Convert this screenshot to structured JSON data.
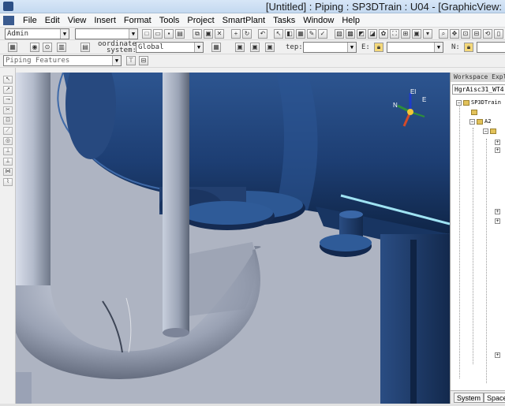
{
  "window": {
    "title": "[Untitled] : Piping : SP3DTrain : U04 - [GraphicView:"
  },
  "menu": [
    "File",
    "Edit",
    "View",
    "Insert",
    "Format",
    "Tools",
    "Project",
    "SmartPlant",
    "Tasks",
    "Window",
    "Help"
  ],
  "toolbar": {
    "task_combo": "Admin",
    "second_combo": "",
    "coordinate_label_line1": "oordinate",
    "coordinate_label_line2": "system:",
    "coordinate_combo": "Global",
    "step_label": "tep:",
    "step_combo": "",
    "e_label": "E:",
    "e_combo": "",
    "n_label": "N:",
    "n_combo": "",
    "filter_combo": "Piping Features"
  },
  "viewport": {
    "compass": {
      "east": "E",
      "north": "N",
      "elevation": "El"
    },
    "colors": {
      "background": "#aeb4c2",
      "vessel": "#1e3f72",
      "pipe": "#b7bfcf"
    }
  },
  "workspace": {
    "header": "Workspace Explorer",
    "filter": "HgrAisc31_WT4",
    "tree": [
      {
        "label": "SP3DTrain",
        "indent": 0,
        "expanded": true
      },
      {
        "label": "",
        "indent": 1,
        "expanded": false
      },
      {
        "label": "A2",
        "indent": 1,
        "expanded": true
      },
      {
        "label": "",
        "indent": 2,
        "expanded": true
      },
      {
        "label": "",
        "indent": 3,
        "expanded": false
      },
      {
        "label": "",
        "indent": 3,
        "expanded": false
      },
      {
        "label": "",
        "indent": 3,
        "expanded": false
      },
      {
        "label": "",
        "indent": 3,
        "expanded": false
      },
      {
        "label": "",
        "indent": 3,
        "expanded": false
      }
    ],
    "tabs": [
      "System",
      "Space"
    ]
  }
}
